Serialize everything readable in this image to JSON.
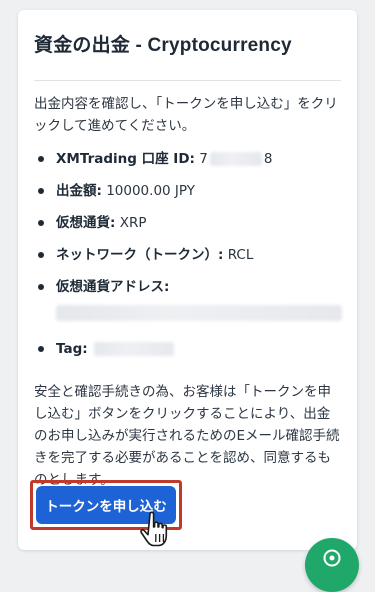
{
  "card": {
    "title": "資金の出金 - Cryptocurrency",
    "intro": "出金内容を確認し、「トークンを申し込む」をクリックして進めてください。",
    "details": {
      "account_id_label": "XMTrading 口座 ID:",
      "account_id_prefix": "7",
      "account_id_suffix": "8",
      "amount_label": "出金額:",
      "amount_value": "10000.00 JPY",
      "currency_label": "仮想通貨:",
      "currency_value": "XRP",
      "network_label": "ネットワーク（トークン）:",
      "network_value": "RCL",
      "address_label": "仮想通貨アドレス:",
      "tag_label": "Tag:"
    },
    "notice": "安全と確認手続きの為、お客様は「トークンを申し込む」ボタンをクリックすることにより、出金のお申し込みが実行されるためのEメール確認手続きを完了する必要があることを認め、同意するものとします。",
    "submit_label": "トークンを申し込む"
  },
  "colors": {
    "button": "#1e63d6",
    "highlight": "#c0392b",
    "fab": "#20a86b"
  },
  "icons": {
    "cursor": "hand-pointer-icon",
    "fab": "chat-icon"
  }
}
